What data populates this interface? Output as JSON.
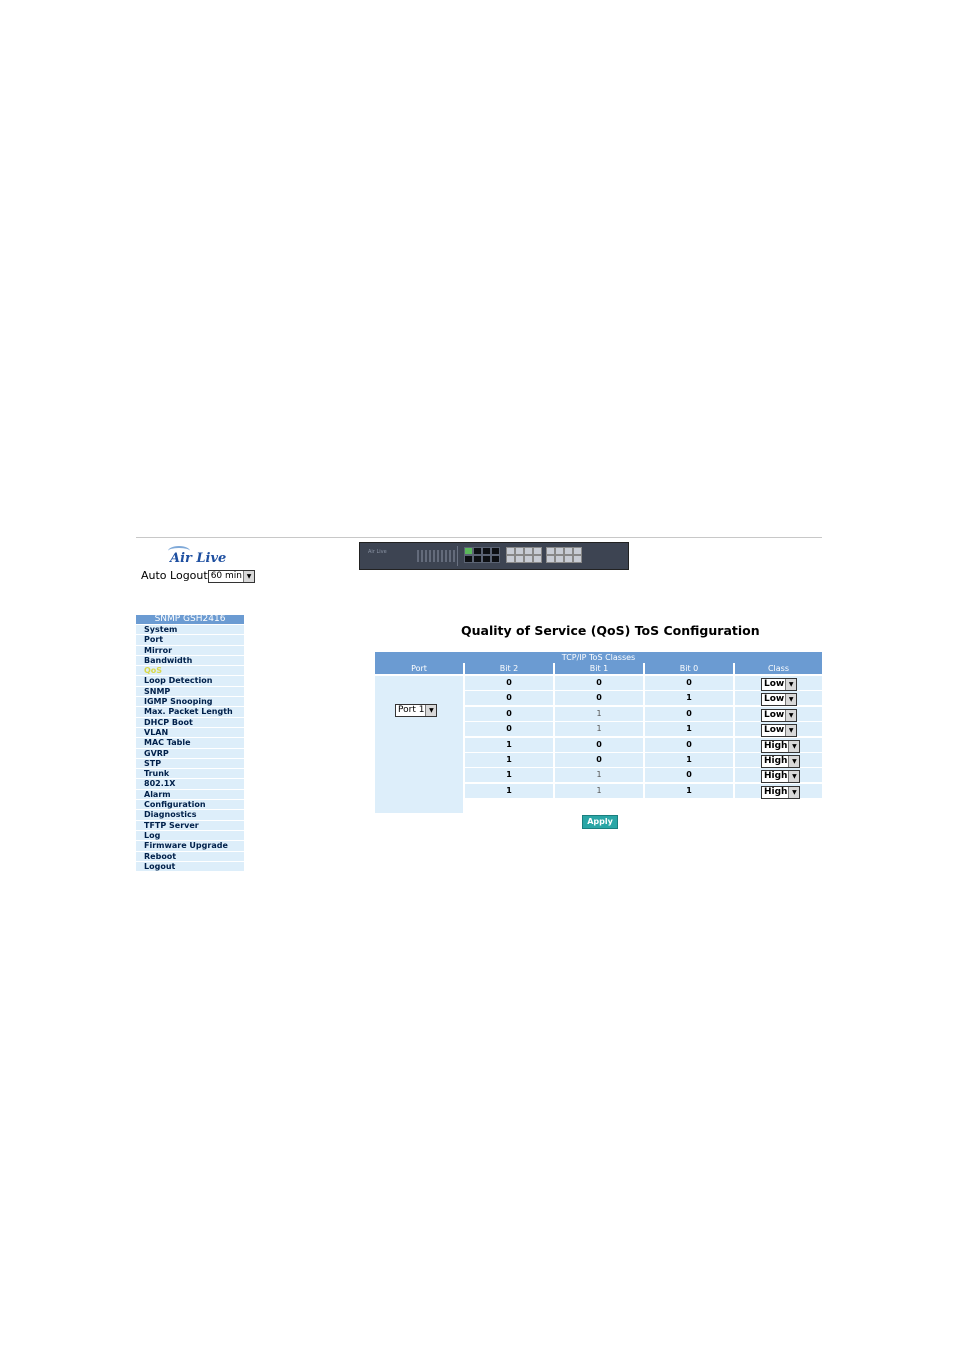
{
  "brand": {
    "logo_text": "Air Live"
  },
  "auto_logout": {
    "label": "Auto Logout",
    "value": "60 min"
  },
  "device": {
    "brand_text": "Air Live"
  },
  "sidebar": {
    "header": "SNMP GSH2416",
    "items": [
      {
        "label": "System"
      },
      {
        "label": "Port"
      },
      {
        "label": "Mirror"
      },
      {
        "label": "Bandwidth"
      },
      {
        "label": "QoS",
        "active": true
      },
      {
        "label": "Loop Detection"
      },
      {
        "label": "SNMP"
      },
      {
        "label": "IGMP Snooping"
      },
      {
        "label": "Max. Packet Length"
      },
      {
        "label": "DHCP Boot"
      },
      {
        "label": "VLAN"
      },
      {
        "label": "MAC Table"
      },
      {
        "label": "GVRP"
      },
      {
        "label": "STP"
      },
      {
        "label": "Trunk"
      },
      {
        "label": "802.1X"
      },
      {
        "label": "Alarm"
      },
      {
        "label": "Configuration"
      },
      {
        "label": "Diagnostics"
      },
      {
        "label": "TFTP Server"
      },
      {
        "label": "Log"
      },
      {
        "label": "Firmware Upgrade"
      },
      {
        "label": "Reboot"
      },
      {
        "label": "Logout"
      }
    ]
  },
  "page": {
    "title": "Quality of Service (QoS) ToS Configuration"
  },
  "tos_table": {
    "caption": "TCP/IP ToS Classes",
    "columns": [
      "Port",
      "Bit 2",
      "Bit 1",
      "Bit 0",
      "Class"
    ],
    "port_value": "Port 1",
    "rows": [
      {
        "bit2": "0",
        "bit1": "0",
        "bit0": "0",
        "class": "Low"
      },
      {
        "bit2": "0",
        "bit1": "0",
        "bit0": "1",
        "class": "Low"
      },
      {
        "bit2": "0",
        "bit1": "1",
        "bit0": "0",
        "class": "Low"
      },
      {
        "bit2": "0",
        "bit1": "1",
        "bit0": "1",
        "class": "Low"
      },
      {
        "bit2": "1",
        "bit1": "0",
        "bit0": "0",
        "class": "High"
      },
      {
        "bit2": "1",
        "bit1": "0",
        "bit0": "1",
        "class": "High"
      },
      {
        "bit2": "1",
        "bit1": "1",
        "bit0": "0",
        "class": "High"
      },
      {
        "bit2": "1",
        "bit1": "1",
        "bit0": "1",
        "class": "High"
      }
    ]
  },
  "apply_label": "Apply",
  "colors": {
    "header_blue": "#6b9bd2",
    "cell_blue": "#ddeefa",
    "apply_teal": "#2aa6a6",
    "active_item": "#d8d84a"
  }
}
